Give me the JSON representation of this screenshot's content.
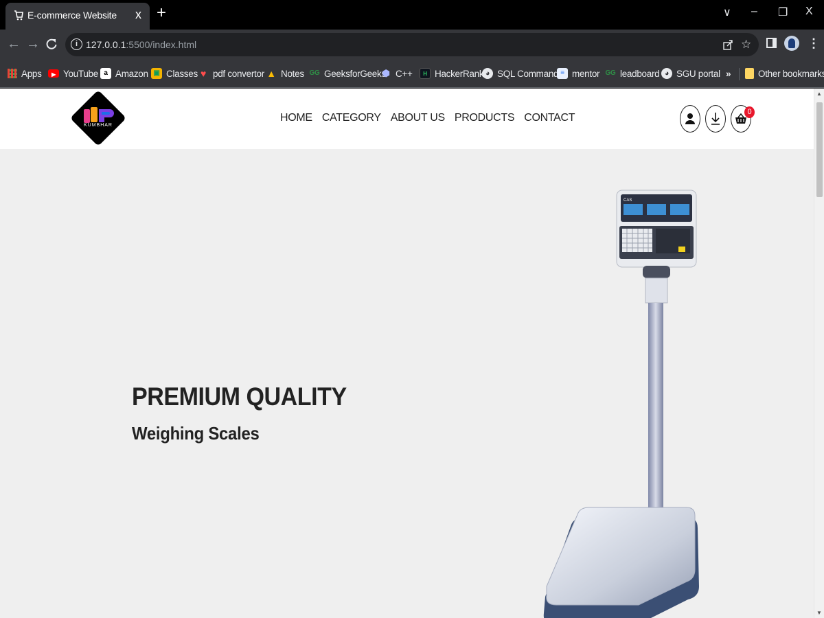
{
  "browser": {
    "tab_title": "E-commerce Website",
    "tab_close": "x",
    "new_tab": "+",
    "url_host": "127.0.0.1",
    "url_path": ":5500/index.html",
    "window_controls": {
      "tab_search": "∨",
      "minimize": "–",
      "restore": "❐",
      "close": "X"
    },
    "bookmarks": [
      {
        "label": "Apps",
        "icon": "apps-grid-icon"
      },
      {
        "label": "YouTube",
        "icon": "youtube-icon"
      },
      {
        "label": "Amazon",
        "icon": "amazon-icon"
      },
      {
        "label": "Classes",
        "icon": "classroom-icon"
      },
      {
        "label": "pdf convertor",
        "icon": "pdf-icon"
      },
      {
        "label": "Notes",
        "icon": "drive-icon"
      },
      {
        "label": "GeeksforGeeks",
        "icon": "gfg-icon"
      },
      {
        "label": "C++",
        "icon": "cpp-icon"
      },
      {
        "label": "HackerRank",
        "icon": "hackerrank-icon"
      },
      {
        "label": "SQL Commands",
        "icon": "globe-icon"
      },
      {
        "label": "mentor",
        "icon": "document-icon"
      },
      {
        "label": "leadboard",
        "icon": "gfg-icon"
      },
      {
        "label": "SGU portal",
        "icon": "globe-icon"
      }
    ],
    "bookmarks_overflow": "»",
    "other_bookmarks": "Other bookmarks"
  },
  "site": {
    "logo_text": "KUMBHAR",
    "nav": [
      "HOME",
      "CATEGORY",
      "ABOUT US",
      "PRODUCTS",
      "CONTACT"
    ],
    "cart_count": "0"
  },
  "hero": {
    "title": "PREMIUM QUALITY",
    "subtitle": "Weighing Scales",
    "scale_brand": "CAS"
  },
  "colors": {
    "header_bg": "#ffffff",
    "hero_bg": "#efefef",
    "badge": "#e8172c",
    "text": "#222222"
  }
}
